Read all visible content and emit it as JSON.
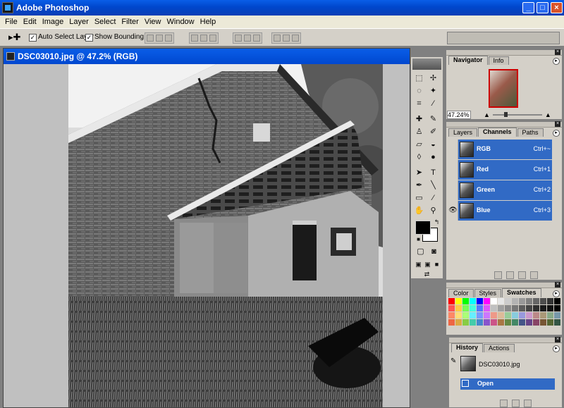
{
  "app": {
    "title": "Adobe Photoshop"
  },
  "window_controls": {
    "minimize": "_",
    "maximize": "□",
    "close": "×"
  },
  "menu": [
    "File",
    "Edit",
    "Image",
    "Layer",
    "Select",
    "Filter",
    "View",
    "Window",
    "Help"
  ],
  "options": {
    "tool_icon": "move-tool",
    "auto_select_label": "Auto Select Layer",
    "auto_select_checked": true,
    "bounding_box_label": "Show Bounding Box",
    "bounding_box_checked": true
  },
  "document": {
    "title": "DSC03010.jpg @ 47.2% (RGB)"
  },
  "navigator": {
    "tabs": [
      "Navigator",
      "Info"
    ],
    "active_tab": "Navigator",
    "zoom": "47.24%"
  },
  "channels": {
    "tabs": [
      "Layers",
      "Channels",
      "Paths"
    ],
    "active_tab": "Channels",
    "rows": [
      {
        "name": "RGB",
        "shortcut": "Ctrl+~",
        "visible": false
      },
      {
        "name": "Red",
        "shortcut": "Ctrl+1",
        "visible": false
      },
      {
        "name": "Green",
        "shortcut": "Ctrl+2",
        "visible": false
      },
      {
        "name": "Blue",
        "shortcut": "Ctrl+3",
        "visible": true
      }
    ]
  },
  "swatches": {
    "tabs": [
      "Color",
      "Styles",
      "Swatches"
    ],
    "active_tab": "Swatches"
  },
  "history": {
    "tabs": [
      "History",
      "Actions"
    ],
    "active_tab": "History",
    "snapshot": "DSC03010.jpg",
    "states": [
      "Open"
    ]
  },
  "colors": {
    "title_blue": "#0a5ee8",
    "selection_blue": "#316ac5",
    "panel_gray": "#d4d0c8",
    "workspace_gray": "#808080"
  }
}
